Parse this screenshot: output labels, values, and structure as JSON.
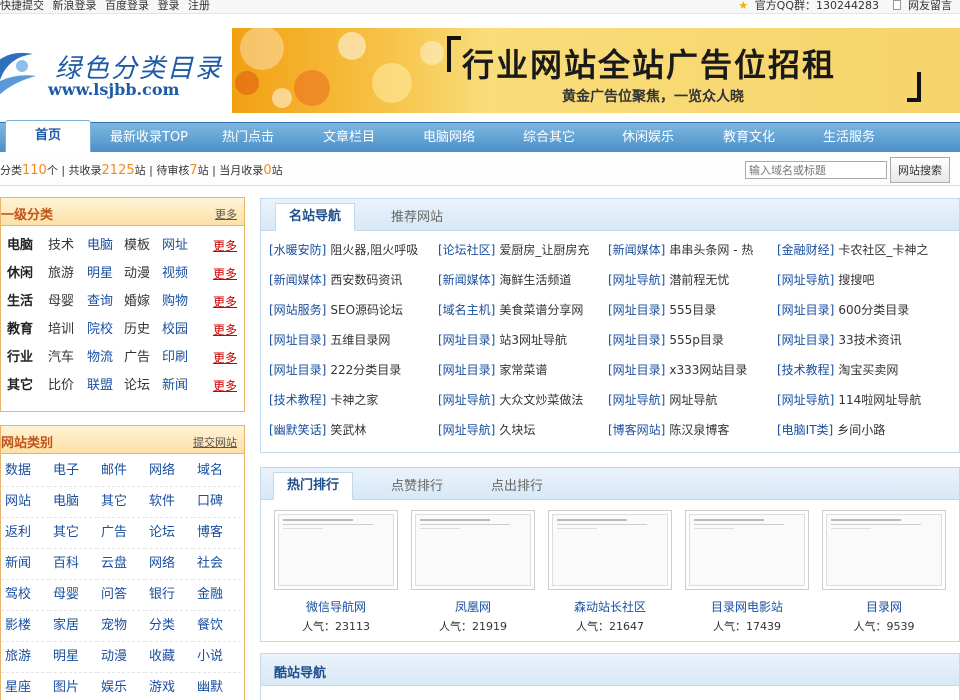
{
  "topbar": {
    "links": [
      "快捷提交",
      "新浪登录",
      "百度登录",
      "登录",
      "注册"
    ],
    "qq_label": "官方QQ群：130244283",
    "guestbook": "网友留言"
  },
  "logo": {
    "name": "绿色分类目录",
    "url": "www.lsjbb.com"
  },
  "banner": {
    "title": "行业网站全站广告位招租",
    "subtitle": "黄金广告位聚焦，一览众人晓"
  },
  "nav": {
    "home": "首页",
    "items": [
      "最新收录TOP",
      "热门点击",
      "文章栏目",
      "电脑网络",
      "综合其它",
      "休闲娱乐",
      "教育文化",
      "生活服务"
    ]
  },
  "stats": {
    "p1": "分类",
    "n1": "110",
    "p2": "个 | 共收录",
    "n2": "2125",
    "p3": "站 | 待审核",
    "n3": "7",
    "p4": "站 | 当月收录",
    "n4": "0",
    "p5": "站",
    "search_placeholder": "输入域名或标题",
    "search_button": "网站搜索"
  },
  "category1": {
    "title": "一级分类",
    "more": "更多",
    "row_more": "更多",
    "rows": [
      [
        "电脑",
        "技术",
        "电脑",
        "模板",
        "网址"
      ],
      [
        "休闲",
        "旅游",
        "明星",
        "动漫",
        "视频"
      ],
      [
        "生活",
        "母婴",
        "查询",
        "婚嫁",
        "购物"
      ],
      [
        "教育",
        "培训",
        "院校",
        "历史",
        "校园"
      ],
      [
        "行业",
        "汽车",
        "物流",
        "广告",
        "印刷"
      ],
      [
        "其它",
        "比价",
        "联盟",
        "论坛",
        "新闻"
      ]
    ]
  },
  "category2": {
    "title": "网站类别",
    "submit": "提交网站",
    "rows": [
      [
        "数据",
        "电子",
        "邮件",
        "网络",
        "域名"
      ],
      [
        "网站",
        "电脑",
        "其它",
        "软件",
        "口碑"
      ],
      [
        "返利",
        "其它",
        "广告",
        "论坛",
        "博客"
      ],
      [
        "新闻",
        "百科",
        "云盘",
        "网络",
        "社会"
      ],
      [
        "驾校",
        "母婴",
        "问答",
        "银行",
        "金融"
      ],
      [
        "影楼",
        "家居",
        "宠物",
        "分类",
        "餐饮"
      ],
      [
        "旅游",
        "明星",
        "动漫",
        "收藏",
        "小说"
      ],
      [
        "星座",
        "图片",
        "娱乐",
        "游戏",
        "幽默"
      ]
    ]
  },
  "famous": {
    "tabs": [
      "名站导航",
      "推荐网站"
    ],
    "rows": [
      [
        [
          "[水暖安防]",
          "阻火器,阻火呼吸"
        ],
        [
          "[论坛社区]",
          "爱厨房_让厨房充"
        ],
        [
          "[新闻媒体]",
          "串串头条网 - 热"
        ],
        [
          "[金融财经]",
          "卡农社区_卡神之"
        ]
      ],
      [
        [
          "[新闻媒体]",
          "西安数码资讯"
        ],
        [
          "[新闻媒体]",
          "海鲜生活频道"
        ],
        [
          "[网址导航]",
          "潜前程无忧"
        ],
        [
          "[网址导航]",
          "搜搜吧"
        ]
      ],
      [
        [
          "[网站服务]",
          "SEO源码论坛"
        ],
        [
          "[域名主机]",
          "美食菜谱分享网"
        ],
        [
          "[网址目录]",
          "555目录"
        ],
        [
          "[网址目录]",
          "600分类目录"
        ]
      ],
      [
        [
          "[网址目录]",
          "五维目录网"
        ],
        [
          "[网址目录]",
          "站3网址导航"
        ],
        [
          "[网址目录]",
          "555p目录"
        ],
        [
          "[网址目录]",
          "33技术资讯"
        ]
      ],
      [
        [
          "[网址目录]",
          "222分类目录"
        ],
        [
          "[网址目录]",
          "家常菜谱"
        ],
        [
          "[网址目录]",
          "x333网站目录"
        ],
        [
          "[技术教程]",
          "淘宝买卖网"
        ]
      ],
      [
        [
          "[技术教程]",
          "卡神之家"
        ],
        [
          "[网址导航]",
          "大众文炒菜做法"
        ],
        [
          "[网址导航]",
          "网址导航"
        ],
        [
          "[网址导航]",
          "114啦网址导航"
        ]
      ],
      [
        [
          "[幽默笑话]",
          "笑武林"
        ],
        [
          "[网址导航]",
          "久块坛"
        ],
        [
          "[博客网站]",
          "陈汉泉博客"
        ],
        [
          "[电脑IT类]",
          "乡间小路"
        ]
      ]
    ]
  },
  "hot": {
    "tabs": [
      "热门排行",
      "点赞排行",
      "点出排行"
    ],
    "pop_label": "人气：",
    "items": [
      {
        "name": "微信导航网",
        "pop": "23113"
      },
      {
        "name": "凤凰网",
        "pop": "21919"
      },
      {
        "name": "森动站长社区",
        "pop": "21647"
      },
      {
        "name": "目录网电影站",
        "pop": "17439"
      },
      {
        "name": "目录网",
        "pop": "9539"
      }
    ]
  },
  "cool": {
    "title": "酷站导航"
  }
}
